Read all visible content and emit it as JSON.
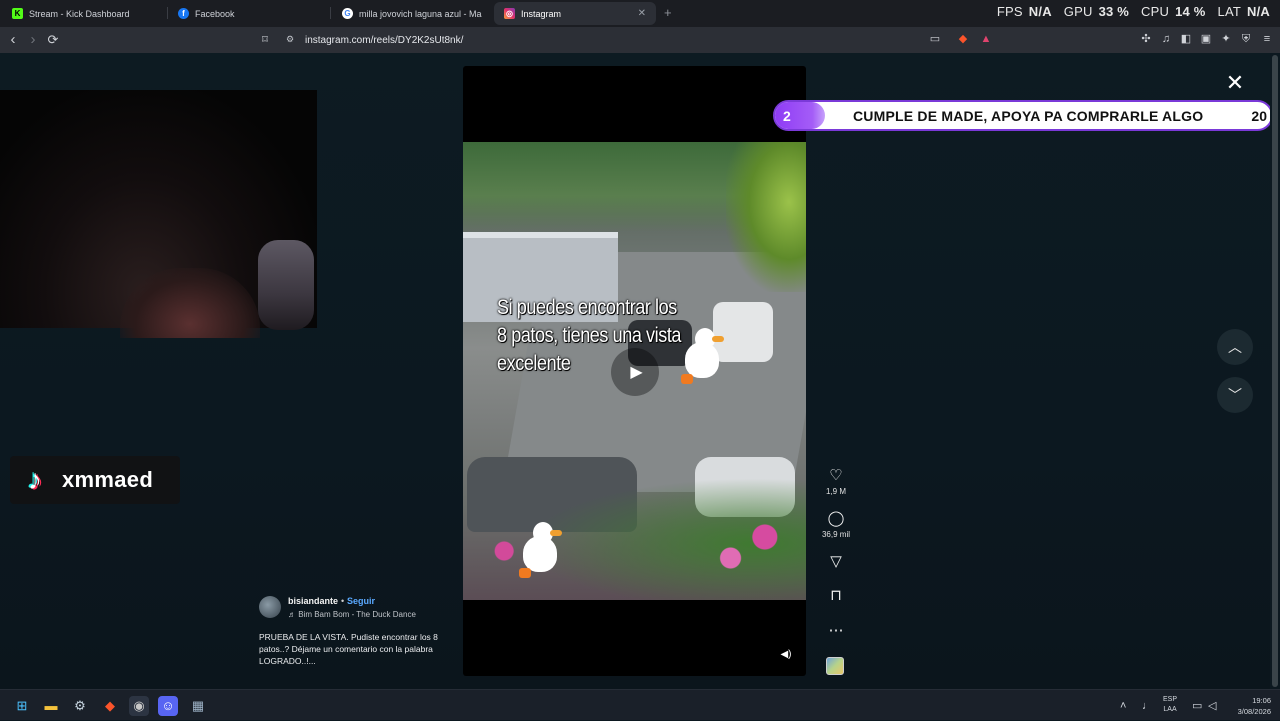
{
  "browser": {
    "tabs": [
      {
        "label": "Stream - Kick Dashboard",
        "icon": "kick-icon"
      },
      {
        "label": "Facebook",
        "icon": "facebook-icon"
      },
      {
        "label": "milla jovovich laguna azul - Mask'ar...",
        "icon": "google-icon"
      },
      {
        "label": "Instagram",
        "icon": "instagram-icon",
        "active": true
      }
    ],
    "new_tab": "+",
    "url": "instagram.com/reels/DY2K2sUt8nk/"
  },
  "perf_overlay": {
    "fps_label": "FPS",
    "fps_value": "N/A",
    "gpu_label": "GPU",
    "gpu_value": "33 %",
    "cpu_label": "CPU",
    "cpu_value": "14 %",
    "lat_label": "LAT",
    "lat_value": "N/A"
  },
  "stream_overlay": {
    "tiktok_handle": "xmmaed",
    "alert": {
      "current": "2",
      "message": "CUMPLE DE MADE, APOYA PA COMPRARLE ALGO",
      "goal": "20",
      "accent": "#8f3bf5"
    }
  },
  "reel": {
    "overlay_text": "Si puedes encontrar los 8 patos, tienes una vista excelente",
    "likes": "1,9 M",
    "comments": "36,9 mil",
    "author": {
      "username": "bisiandante",
      "separator": "•",
      "follow_label": "Seguir",
      "song": "♬ Bim Bam Bom - The Duck Dance"
    },
    "caption": "PRUEBA DE LA VISTA. Pudiste encontrar los 8 patos..? Déjame un comentario con la palabra LOGRADO..!..."
  },
  "taskbar": {
    "lang_line1": "ESP",
    "lang_line2": "LAA",
    "time": "19:06",
    "date": "3/08/2026"
  }
}
